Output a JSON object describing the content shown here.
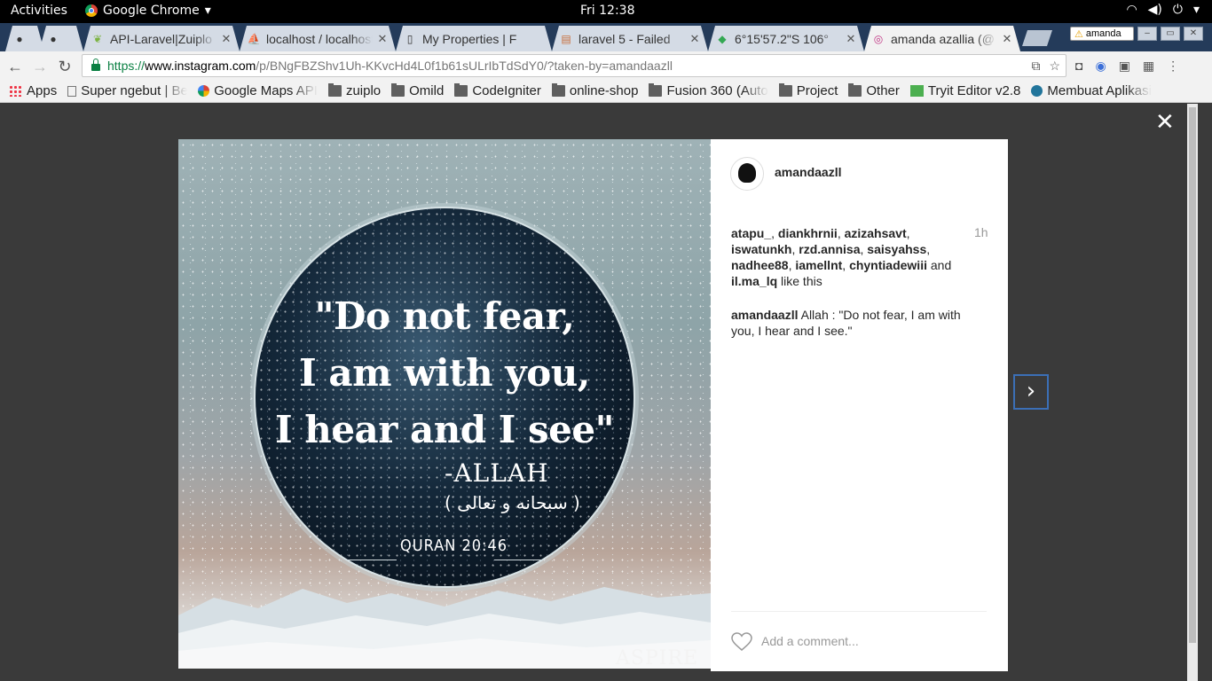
{
  "topbar": {
    "activities": "Activities",
    "app_name": "Google Chrome",
    "clock": "Fri 12:38"
  },
  "tabs": [
    {
      "icon": "github-icon",
      "title": ""
    },
    {
      "icon": "github-icon",
      "title": ""
    },
    {
      "icon": "laravel-leaf-icon",
      "title": "API-Laravel|Zuiplo"
    },
    {
      "icon": "phpmyadmin-icon",
      "title": "localhost / localhost"
    },
    {
      "icon": "document-icon",
      "title": "My Properties | F"
    },
    {
      "icon": "stackoverflow-icon",
      "title": "laravel 5 - Failed"
    },
    {
      "icon": "google-maps-icon",
      "title": "6°15'57.2\"S 106°"
    },
    {
      "icon": "instagram-icon",
      "title": "amanda azallia (@",
      "active": true
    }
  ],
  "profile_badge": "amanda",
  "address_bar": {
    "scheme": "https://",
    "domain": "www.instagram.com",
    "path": "/p/BNgFBZShv1Uh-KKvcHd4L0f1b61sULrIbTdSdY0/?taken-by=amandaazll"
  },
  "bookmarks": [
    {
      "icon": "apps-icon",
      "label": "Apps"
    },
    {
      "icon": "page-icon",
      "label": "Super ngebut | Be"
    },
    {
      "icon": "google-icon",
      "label": "Google Maps API"
    },
    {
      "icon": "folder-icon",
      "label": "zuiplo"
    },
    {
      "icon": "folder-icon",
      "label": "Omild"
    },
    {
      "icon": "folder-icon",
      "label": "CodeIgniter"
    },
    {
      "icon": "folder-icon",
      "label": "online-shop"
    },
    {
      "icon": "folder-icon",
      "label": "Fusion 360 (Auto"
    },
    {
      "icon": "folder-icon",
      "label": "Project"
    },
    {
      "icon": "folder-icon",
      "label": "Other"
    },
    {
      "icon": "tryit-icon",
      "label": "Tryit Editor v2.8"
    },
    {
      "icon": "wordpress-icon",
      "label": "Membuat Aplikasi"
    }
  ],
  "image": {
    "quote_line1": "\"Do not fear,",
    "quote_line2": "I am with you,",
    "quote_line3": "I hear and I see\"",
    "author": "-ALLAH",
    "arabic": "( سبحانه و تعالى )",
    "surah": "QURAN 20:46",
    "watermark": "ASPIRE"
  },
  "post": {
    "username": "amandaazll",
    "time": "1h",
    "likers": [
      "atapu_",
      "diankhrnii",
      "azizahsavt",
      "iswatunkh",
      "rzd.annisa",
      "saisyahss",
      "nadhee88",
      "iamellnt",
      "chyntiadewiii"
    ],
    "likers_and": "and",
    "last_liker": "il.ma_lq",
    "like_suffix": "like this",
    "caption_user": "amandaazll",
    "caption_text": "Allah : \"Do not fear, I am with you, I hear and I see.\"",
    "comment_placeholder": "Add a comment..."
  },
  "icons": {
    "close": "close-icon",
    "next": "chevron-right-icon",
    "like": "heart-icon"
  },
  "colors": {
    "next_button_border": "#3b6fb6",
    "backdrop": "#3a3a3a"
  }
}
